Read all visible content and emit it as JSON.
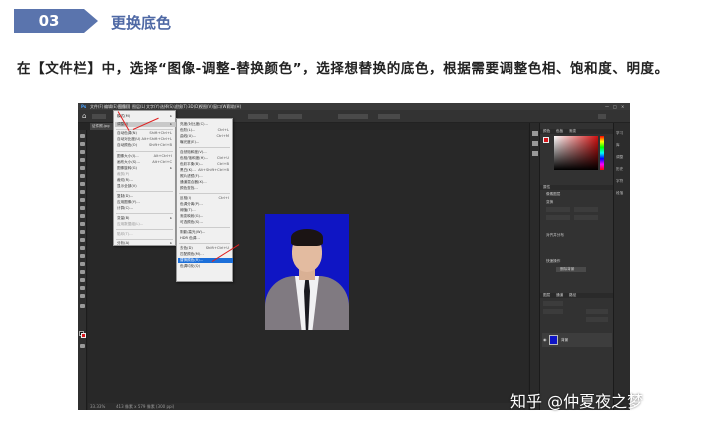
{
  "step": {
    "number": "03",
    "title": "更换底色"
  },
  "instruction": "在【文件栏】中，选择“图像-调整-替换颜色”，选择想替换的底色，根据需要调整色相、饱和度、明度。",
  "photoshop": {
    "menubar": [
      "文件(F)",
      "编辑(E)",
      "图像(I)",
      "图层(L)",
      "文字(Y)",
      "选择(S)",
      "滤镜(T)",
      "3D(D)",
      "视图(V)",
      "窗口(W)",
      "帮助(H)"
    ],
    "window_controls": [
      "—",
      "□",
      "×"
    ],
    "doc_tab": "证件照.jpg",
    "image_menu": [
      {
        "label": "模式(M)",
        "shortcut": ""
      },
      {
        "label": "调整(J)",
        "shortcut": ""
      },
      {
        "label": "自动色调(N)",
        "shortcut": "Shift+Ctrl+L"
      },
      {
        "label": "自动对比度(U)",
        "shortcut": "Alt+Shift+Ctrl+L"
      },
      {
        "label": "自动颜色(O)",
        "shortcut": "Shift+Ctrl+B"
      },
      {
        "label": "图像大小(I)...",
        "shortcut": "Alt+Ctrl+I"
      },
      {
        "label": "画布大小(S)...",
        "shortcut": "Alt+Ctrl+C"
      },
      {
        "label": "图像旋转(G)",
        "shortcut": ""
      },
      {
        "label": "裁剪(P)",
        "shortcut": ""
      },
      {
        "label": "裁切(R)...",
        "shortcut": ""
      },
      {
        "label": "显示全部(V)",
        "shortcut": ""
      },
      {
        "label": "复制(D)...",
        "shortcut": ""
      },
      {
        "label": "应用图像(Y)...",
        "shortcut": ""
      },
      {
        "label": "计算(C)...",
        "shortcut": ""
      },
      {
        "label": "变量(B)",
        "shortcut": ""
      },
      {
        "label": "应用数据组(L)...",
        "shortcut": ""
      },
      {
        "label": "陷印(T)...",
        "shortcut": ""
      },
      {
        "label": "分析(A)",
        "shortcut": ""
      }
    ],
    "adjust_menu": [
      {
        "label": "亮度/对比度(C)...",
        "shortcut": ""
      },
      {
        "label": "色阶(L)...",
        "shortcut": "Ctrl+L"
      },
      {
        "label": "曲线(U)...",
        "shortcut": "Ctrl+M"
      },
      {
        "label": "曝光度(E)...",
        "shortcut": ""
      },
      {
        "label": "自然饱和度(V)...",
        "shortcut": ""
      },
      {
        "label": "色相/饱和度(H)...",
        "shortcut": "Ctrl+U"
      },
      {
        "label": "色彩平衡(B)...",
        "shortcut": "Ctrl+B"
      },
      {
        "label": "黑白(K)...",
        "shortcut": "Alt+Shift+Ctrl+B"
      },
      {
        "label": "照片滤镜(F)...",
        "shortcut": ""
      },
      {
        "label": "通道混合器(X)...",
        "shortcut": ""
      },
      {
        "label": "颜色查找...",
        "shortcut": ""
      },
      {
        "label": "反相(I)",
        "shortcut": "Ctrl+I"
      },
      {
        "label": "色调分离(P)...",
        "shortcut": ""
      },
      {
        "label": "阈值(T)...",
        "shortcut": ""
      },
      {
        "label": "渐变映射(G)...",
        "shortcut": ""
      },
      {
        "label": "可选颜色(S)...",
        "shortcut": ""
      },
      {
        "label": "阴影/高光(W)...",
        "shortcut": ""
      },
      {
        "label": "HDR 色调...",
        "shortcut": ""
      },
      {
        "label": "去色(D)",
        "shortcut": "Shift+Ctrl+U"
      },
      {
        "label": "匹配颜色(M)...",
        "shortcut": ""
      },
      {
        "label": "替换颜色(R)...",
        "shortcut": ""
      },
      {
        "label": "色调均化(Q)",
        "shortcut": ""
      }
    ],
    "highlighted_item": "替换颜色(R)...",
    "panels": {
      "color_tabs": [
        "颜色",
        "色板",
        "渐变"
      ],
      "properties_tab": "属性",
      "properties_labels": [
        "像素图层",
        "变换",
        "对齐并分布",
        "快速操作",
        "删除背景"
      ],
      "layers_tabs": [
        "图层",
        "通道",
        "路径"
      ],
      "layer_name": "背景",
      "side_labels": [
        "学习",
        "库",
        "调整",
        "历史",
        "字符",
        "段落"
      ]
    },
    "status": {
      "zoom": "33.33%",
      "size": "413 像素 x 579 像素 (300 ppi)"
    }
  },
  "watermark": "知乎 @仲夏夜之梦",
  "colors": {
    "accent": "#5a74ad",
    "photo_bg": "#0f15c4",
    "highlight": "#1c6fd9",
    "arrow": "#e02020"
  }
}
